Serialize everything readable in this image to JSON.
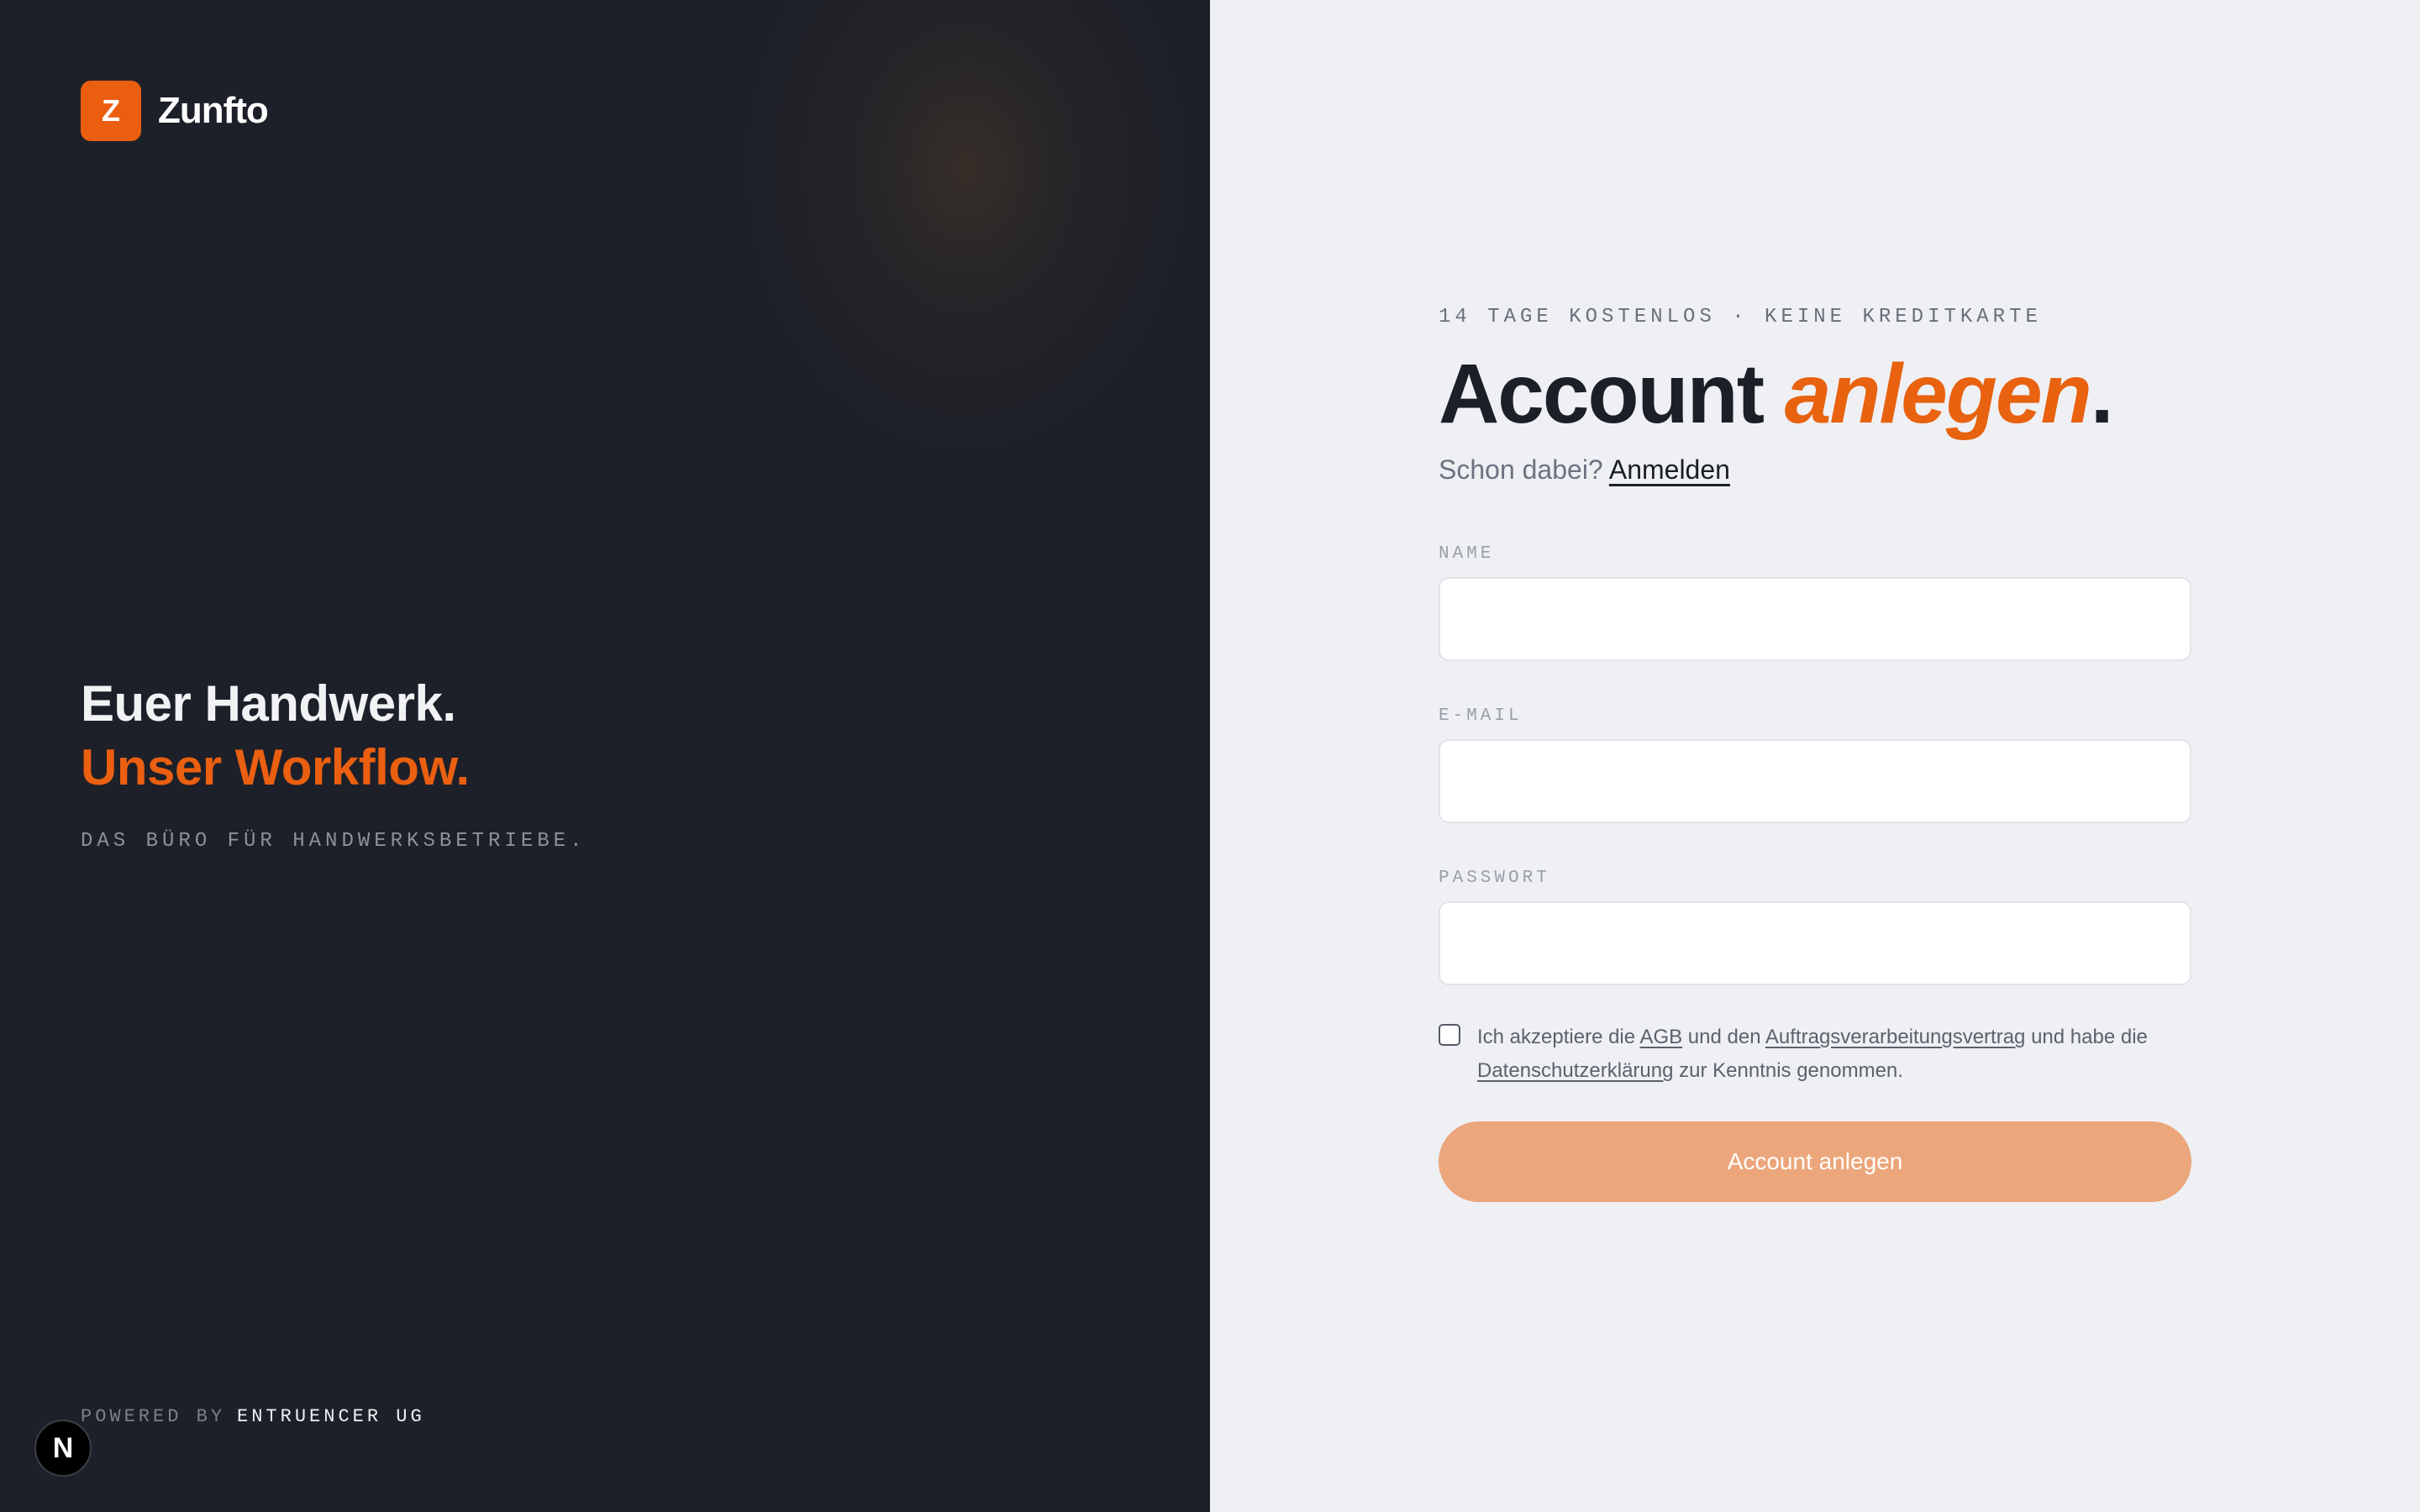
{
  "brand": {
    "logo_letter": "Z",
    "name": "Zunfto",
    "accent_color": "#eb5e0f"
  },
  "hero": {
    "line1": "Euer Handwerk.",
    "line2": "Unser Workflow.",
    "tagline": "DAS BÜRO FÜR HANDWERKSBETRIEBE."
  },
  "footer": {
    "powered_prefix": "POWERED BY",
    "powered_company": "ENTRUENCER UG"
  },
  "dev_badge": {
    "letter": "N"
  },
  "signup": {
    "eyebrow": "14 TAGE KOSTENLOS · KEINE KREDITKARTE",
    "title_main": "Account ",
    "title_accent": "anlegen",
    "title_end": ".",
    "signin_prompt": "Schon dabei? ",
    "signin_link": "Anmelden",
    "fields": {
      "name_label": "NAME",
      "name_value": "",
      "email_label": "E-MAIL",
      "email_value": "",
      "password_label": "PASSWORT",
      "password_value": ""
    },
    "consent": {
      "checked": false,
      "part1": "Ich akzeptiere die ",
      "agb_link": "AGB",
      "part2": " und den ",
      "avv_link": "Auftragsverarbeitungsvertrag",
      "part3": " und habe die ",
      "privacy_link": "Datenschutzerklärung",
      "part4": " zur Kenntnis genommen."
    },
    "submit_label": "Account anlegen",
    "submit_color": "#eca67b"
  }
}
